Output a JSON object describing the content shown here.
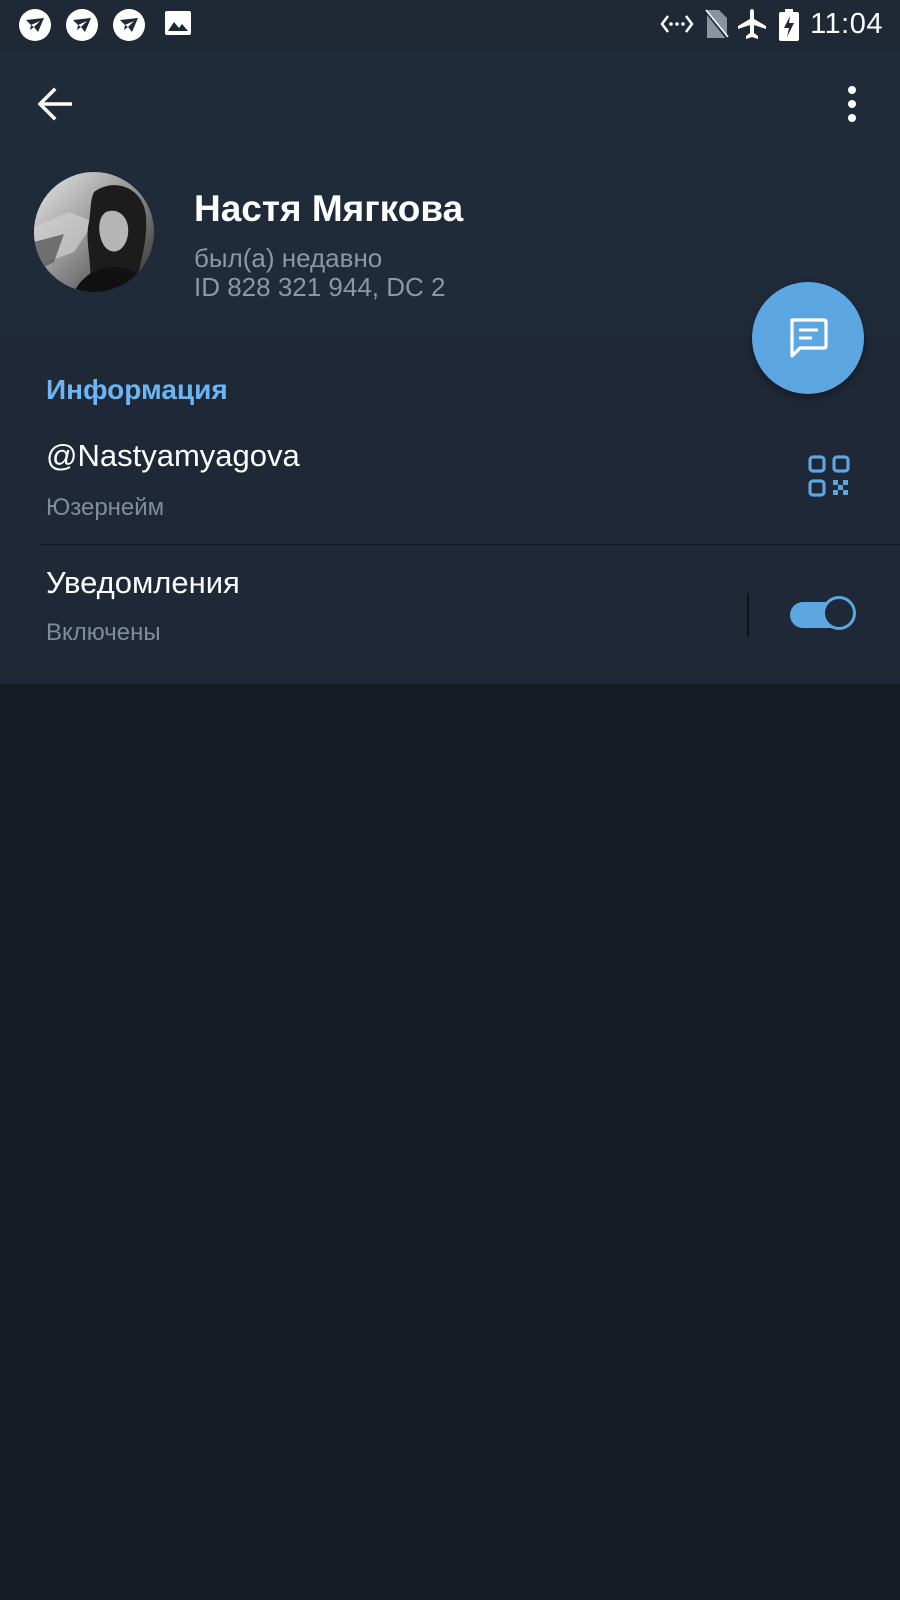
{
  "status_bar": {
    "time": "11:04",
    "left_icons": [
      "telegram-icon",
      "telegram-icon",
      "telegram-icon",
      "image-icon"
    ],
    "right_icons": [
      "data-saver-icon",
      "no-sim-icon",
      "airplane-mode-icon",
      "battery-charging-icon"
    ]
  },
  "header": {
    "back_icon": "arrow-left-icon",
    "menu_icon": "more-vertical-icon"
  },
  "profile": {
    "name": "Настя Мягкова",
    "status": "был(а) недавно",
    "id_line": "ID 828 321 944, DC 2"
  },
  "fab": {
    "icon": "message-icon"
  },
  "info": {
    "title": "Информация",
    "username": {
      "value": "@Nastyamyagova",
      "label": "Юзернейм",
      "icon": "qr-code-icon"
    },
    "notifications": {
      "title": "Уведомления",
      "value": "Включены",
      "toggle_on": true
    }
  },
  "colors": {
    "accent": "#5ca6e2",
    "section_title": "#6cb5f2",
    "header_bg": "#202b3a",
    "background": "#161c26"
  }
}
